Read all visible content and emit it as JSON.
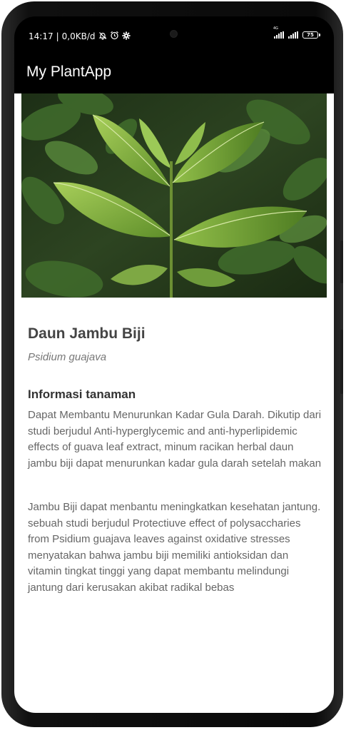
{
  "status_bar": {
    "time": "14:17",
    "separator": "|",
    "network_speed": "0,0KB/d",
    "icons": [
      "mute-bell-icon",
      "alarm-icon",
      "settings-gear-icon"
    ],
    "network_tag": "4G",
    "battery": "75"
  },
  "app_bar": {
    "title": "My PlantApp"
  },
  "plant": {
    "name": "Daun Jambu Biji",
    "latin": "Psidium guajava",
    "section_title": "Informasi tanaman",
    "paragraph_1": "Dapat Membantu Menurunkan Kadar Gula Darah. Dikutip dari studi berjudul Anti-hyperglycemic and anti-hyperlipidemic effects of guava leaf extract, minum racikan herbal daun jambu biji dapat menurunkan kadar gula darah setelah makan",
    "paragraph_2": "Jambu Biji dapat menbantu meningkatkan kesehatan jantung. sebuah studi berjudul Protectiuve effect of polysaccharies from Psidium guajava leaves against oxidative stresses menyatakan bahwa jambu biji memiliki antioksidan dan vitamin tingkat tinggi yang dapat membantu melindungi jantung dari kerusakan akibat radikal bebas"
  },
  "colors": {
    "app_bar_bg": "#000000",
    "content_bg": "#ffffff",
    "title_text": "#444444",
    "body_text": "#666666",
    "leaf_green": "#7fb03a"
  }
}
